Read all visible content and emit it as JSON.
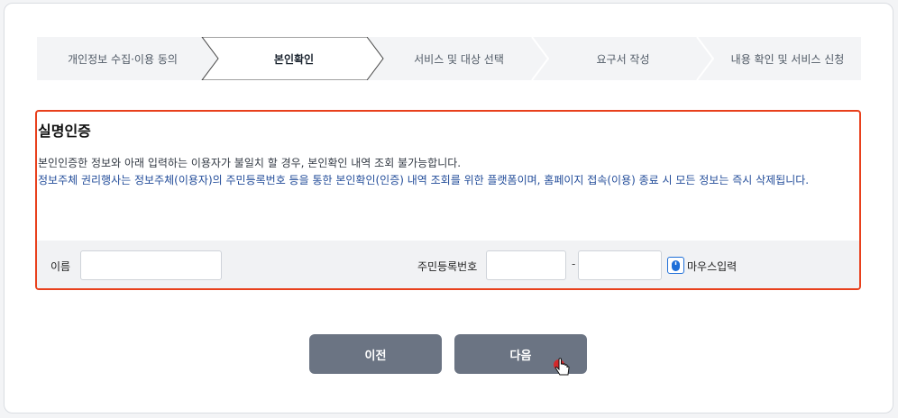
{
  "stepper": {
    "steps": [
      {
        "label": "개인정보 수집·이용 동의",
        "active": false
      },
      {
        "label": "본인확인",
        "active": true
      },
      {
        "label": "서비스 및 대상 선택",
        "active": false
      },
      {
        "label": "요구서 작성",
        "active": false
      },
      {
        "label": "내용 확인 및 서비스 신청",
        "active": false
      }
    ]
  },
  "verification": {
    "title": "실명인증",
    "notice": "본인인증한 정보와 아래 입력하는 이용자가 불일치 할 경우, 본인확인 내역 조회 불가능합니다.",
    "notice_blue": "정보주체 권리행사는 정보주체(이용자)의 주민등록번호 등을 통한 본인확인(인증) 내역 조회를 위한 플랫폼이며, 홈페이지 접속(이용) 종료 시 모든 정보는 즉시 삭제됩니다."
  },
  "form": {
    "name_label": "이름",
    "name_value": "",
    "rrn_label": "주민등록번호",
    "rrn_front_value": "",
    "rrn_separator": "-",
    "rrn_back_value": "",
    "mouse_input_label": "마우스입력"
  },
  "buttons": {
    "prev_label": "이전",
    "next_label": "다음"
  },
  "colors": {
    "accent_border": "#e8401c",
    "blue_text": "#234d9a",
    "button_bg": "#6b7483",
    "mouse_icon": "#1f6fd8"
  }
}
